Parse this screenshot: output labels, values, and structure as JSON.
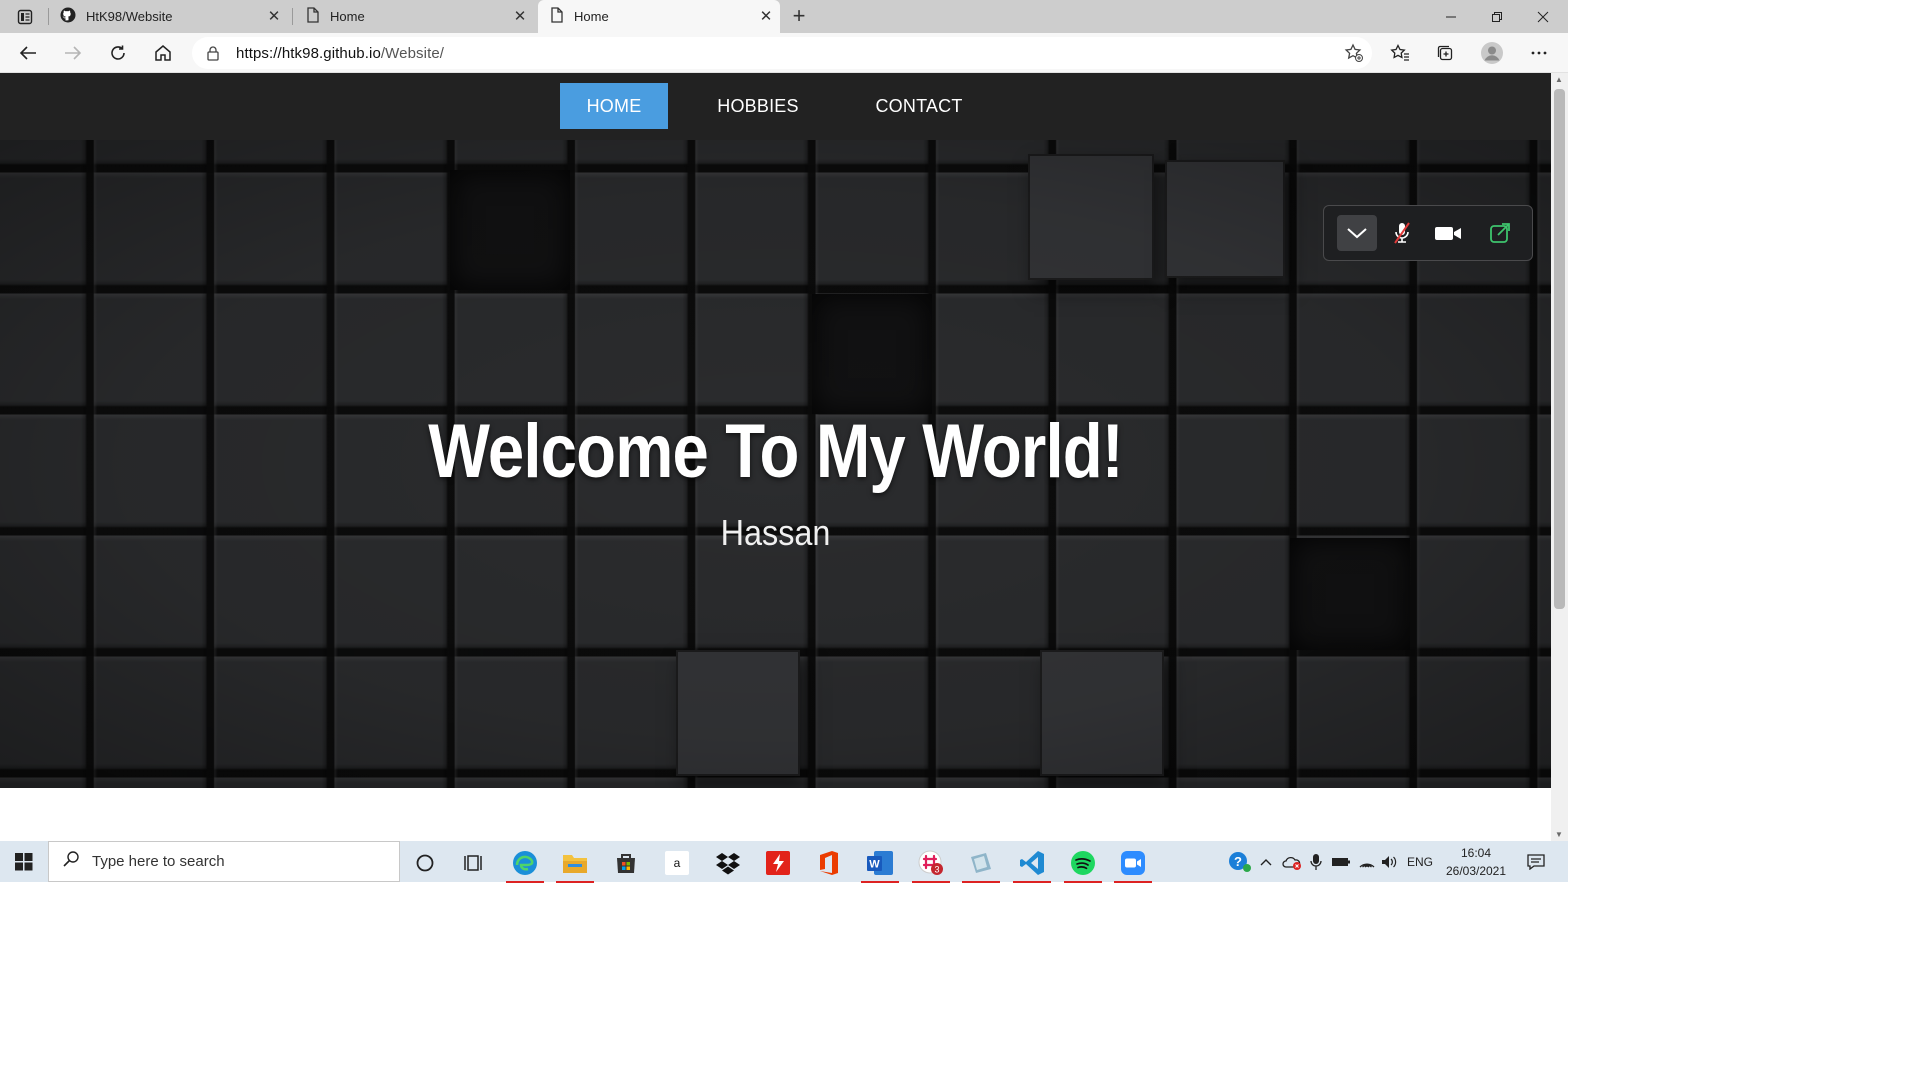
{
  "browser": {
    "tabs": [
      {
        "label": "HtK98/Website",
        "icon": "github-icon",
        "active": false
      },
      {
        "label": "Home",
        "icon": "page-icon",
        "active": false
      },
      {
        "label": "Home",
        "icon": "page-icon",
        "active": true
      }
    ],
    "url": {
      "host": "https://htk98.github.io",
      "path": "/Website/"
    }
  },
  "site": {
    "nav": [
      {
        "label": "HOME",
        "active": true
      },
      {
        "label": "HOBBIES",
        "active": false
      },
      {
        "label": "CONTACT",
        "active": false
      }
    ],
    "hero": {
      "title": "Welcome To My World!",
      "subtitle": "Hassan"
    },
    "accent": "#4a9de0",
    "call_controls": [
      "chevron-down-icon",
      "mic-muted-icon",
      "video-camera-icon",
      "share-screen-icon"
    ]
  },
  "taskbar": {
    "search_placeholder": "Type here to search",
    "language": "ENG",
    "time": "16:04",
    "date": "26/03/2021",
    "badge_count": "3"
  }
}
